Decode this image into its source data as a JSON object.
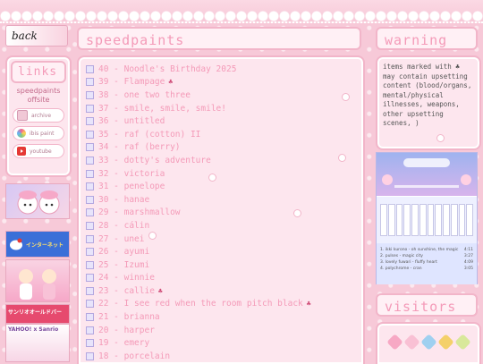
{
  "nav": {
    "back_label": "back"
  },
  "links": {
    "title": "links",
    "offsite_label": "speedpaints offsite",
    "items": [
      {
        "label": "archive",
        "icon": "archive-icon",
        "color": "#f0c8d6"
      },
      {
        "label": "ibis paint",
        "icon": "ibis-paint-icon",
        "color": "#a8d8f0"
      },
      {
        "label": "youtube",
        "icon": "youtube-icon",
        "color": "#e53935"
      }
    ]
  },
  "stamps": [
    {
      "label": "",
      "color": "#c8b8f0"
    },
    {
      "label": "インターネット",
      "color": "#3b6fd8"
    },
    {
      "label": "",
      "color": "#f6a8c8"
    },
    {
      "label": "サンリオオールドバー",
      "color": "#e64a6e"
    },
    {
      "label": "YAHOO! x Sanrio",
      "color": "#f7d6e6"
    }
  ],
  "main": {
    "title": "speedpaints",
    "items": [
      {
        "label": "40 - Noodle's Birthday 2025",
        "warning": false
      },
      {
        "label": "39 - Flampage",
        "warning": true
      },
      {
        "label": "38 - one two three",
        "warning": false
      },
      {
        "label": "37 - smile, smile, smile!",
        "warning": false
      },
      {
        "label": "36 - untitled",
        "warning": false
      },
      {
        "label": "35 - raf (cotton) II",
        "warning": false
      },
      {
        "label": "34 - raf (berry)",
        "warning": false
      },
      {
        "label": "33 - dotty's adventure",
        "warning": false
      },
      {
        "label": "32 - victoria",
        "warning": false
      },
      {
        "label": "31 - penelope",
        "warning": false
      },
      {
        "label": "30 - hanae",
        "warning": false
      },
      {
        "label": "29 - marshmallow",
        "warning": false
      },
      {
        "label": "28 - cálin",
        "warning": false
      },
      {
        "label": "27 - unei",
        "warning": false
      },
      {
        "label": "26 - ayumi",
        "warning": false
      },
      {
        "label": "25 - Izumi",
        "warning": false
      },
      {
        "label": "24 - winnie",
        "warning": false
      },
      {
        "label": "23 - callie",
        "warning": true
      },
      {
        "label": "22 - I see red when the room pitch black",
        "warning": true
      },
      {
        "label": "21 - brianna",
        "warning": false
      },
      {
        "label": "20 - harper",
        "warning": false
      },
      {
        "label": "19 - emery",
        "warning": false
      },
      {
        "label": "18 - porcelain",
        "warning": false
      }
    ]
  },
  "warning": {
    "title": "warning",
    "text": "items marked with ♣ may contain upsetting content (blood/organs, mental/physical illnesses, weapons, other upsetting scenes, )"
  },
  "music": {
    "tracks": [
      {
        "name": "1. ikki kurono - oh sunshine, the magic",
        "time": "4:11"
      },
      {
        "name": "2. pulses - magic city",
        "time": "3:27"
      },
      {
        "name": "3. lovely fuwari - fluffy heart",
        "time": "4:09"
      },
      {
        "name": "4. polychrome - cran",
        "time": "3:05"
      }
    ]
  },
  "visitors": {
    "title": "visitors",
    "hearts": [
      "#f7a8c4",
      "#f9c0d4",
      "#9fd0f0",
      "#f4d06a",
      "#d8e89a"
    ]
  }
}
